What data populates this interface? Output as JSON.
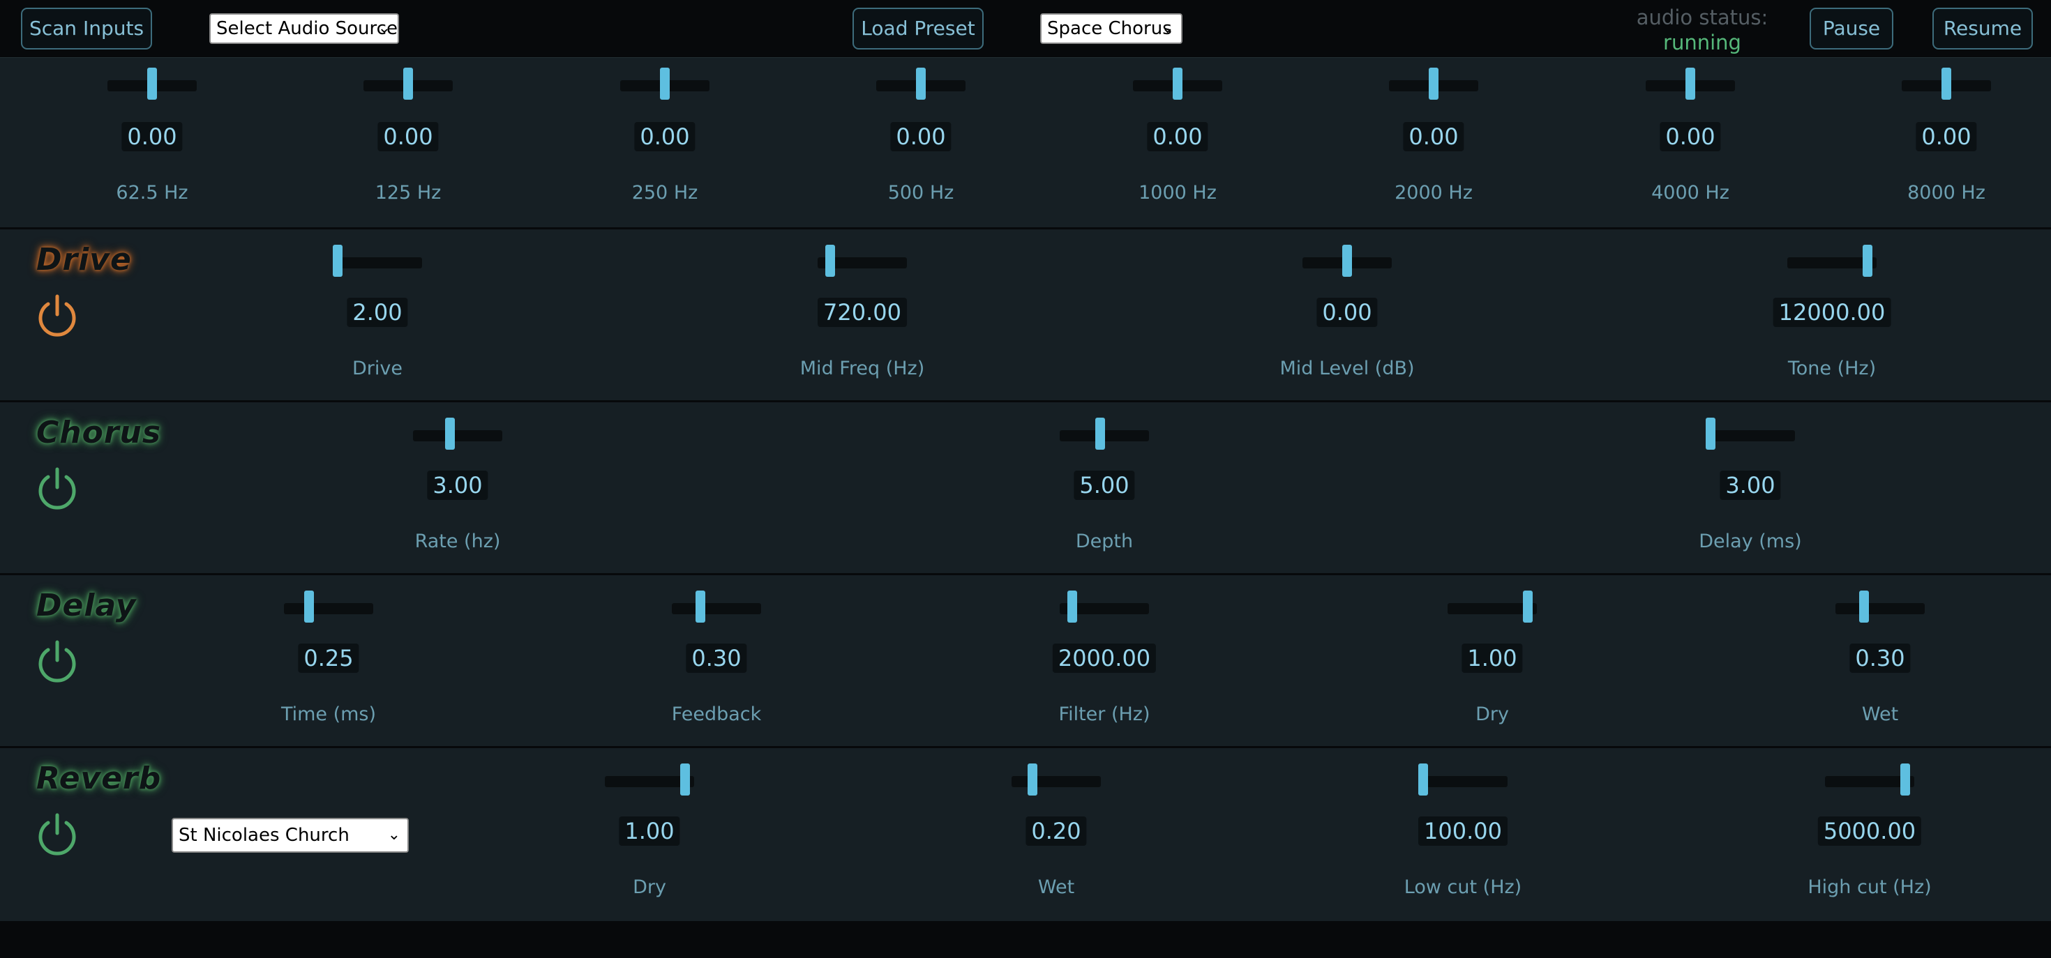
{
  "topbar": {
    "scan_inputs": "Scan Inputs",
    "audio_source": "Select Audio Source",
    "load_preset": "Load Preset",
    "preset": "Space Chorus",
    "status_label": "audio status:",
    "status_value": "running",
    "pause": "Pause",
    "resume": "Resume"
  },
  "eq": {
    "bands": [
      {
        "label": "62.5 Hz",
        "value": "0.00",
        "level": 0.5
      },
      {
        "label": "125 Hz",
        "value": "0.00",
        "level": 0.5
      },
      {
        "label": "250 Hz",
        "value": "0.00",
        "level": 0.5
      },
      {
        "label": "500 Hz",
        "value": "0.00",
        "level": 0.5
      },
      {
        "label": "1000 Hz",
        "value": "0.00",
        "level": 0.5
      },
      {
        "label": "2000 Hz",
        "value": "0.00",
        "level": 0.5
      },
      {
        "label": "4000 Hz",
        "value": "0.00",
        "level": 0.5
      },
      {
        "label": "8000 Hz",
        "value": "0.00",
        "level": 0.5
      }
    ]
  },
  "drive": {
    "title": "Drive",
    "params": [
      {
        "label": "Drive",
        "value": "2.00",
        "level": 0.0
      },
      {
        "label": "Mid Freq (Hz)",
        "value": "720.00",
        "level": 0.1
      },
      {
        "label": "Mid Level (dB)",
        "value": "0.00",
        "level": 0.5
      },
      {
        "label": "Tone (Hz)",
        "value": "12000.00",
        "level": 0.95
      }
    ]
  },
  "chorus": {
    "title": "Chorus",
    "params": [
      {
        "label": "Rate (hz)",
        "value": "3.00",
        "level": 0.4
      },
      {
        "label": "Depth",
        "value": "5.00",
        "level": 0.45
      },
      {
        "label": "Delay (ms)",
        "value": "3.00",
        "level": 0.0
      }
    ]
  },
  "delay": {
    "title": "Delay",
    "params": [
      {
        "label": "Time (ms)",
        "value": "0.25",
        "level": 0.25
      },
      {
        "label": "Feedback",
        "value": "0.30",
        "level": 0.3
      },
      {
        "label": "Filter (Hz)",
        "value": "2000.00",
        "level": 0.1
      },
      {
        "label": "Dry",
        "value": "1.00",
        "level": 0.95
      },
      {
        "label": "Wet",
        "value": "0.30",
        "level": 0.3
      }
    ]
  },
  "reverb": {
    "title": "Reverb",
    "impulse": "St Nicolaes Church",
    "params": [
      {
        "label": "Dry",
        "value": "1.00",
        "level": 0.95
      },
      {
        "label": "Wet",
        "value": "0.20",
        "level": 0.2
      },
      {
        "label": "Low cut (Hz)",
        "value": "100.00",
        "level": 0.0
      },
      {
        "label": "High cut (Hz)",
        "value": "5000.00",
        "level": 0.95
      }
    ]
  },
  "colors": {
    "accent": "#5ebfe0",
    "drive_glow": "#c2692a",
    "fx_glow": "#4c9a5e",
    "status_running": "#56b87a"
  }
}
